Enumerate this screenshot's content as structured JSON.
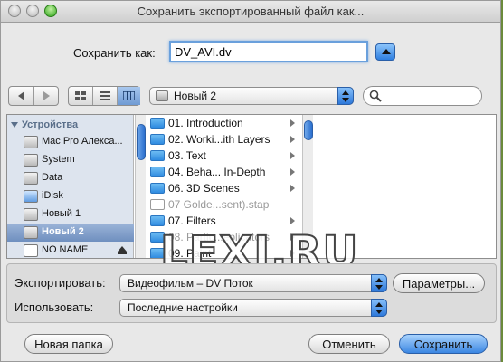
{
  "window": {
    "title": "Сохранить экспортированный файл как..."
  },
  "save": {
    "label": "Сохранить как:",
    "value": "DV_AVI.dv"
  },
  "location": {
    "selected": "Новый 2"
  },
  "sidebar": {
    "heading": "Устройства",
    "items": [
      {
        "label": "Mac Pro Алекса...",
        "icon": "computer-icon"
      },
      {
        "label": "System",
        "icon": "hard-drive-icon"
      },
      {
        "label": "Data",
        "icon": "hard-drive-icon"
      },
      {
        "label": "iDisk",
        "icon": "idisk-icon"
      },
      {
        "label": "Новый 1",
        "icon": "hard-drive-icon"
      },
      {
        "label": "Новый 2",
        "icon": "hard-drive-icon",
        "selected": true
      },
      {
        "label": "NO NAME",
        "icon": "disk-icon",
        "eject": true
      }
    ]
  },
  "files": [
    {
      "label": "01. Introduction",
      "type": "folder"
    },
    {
      "label": "02. Worki...ith Layers",
      "type": "folder"
    },
    {
      "label": "03. Text",
      "type": "folder"
    },
    {
      "label": "04. Beha... In-Depth",
      "type": "folder"
    },
    {
      "label": "06. 3D Scenes",
      "type": "folder"
    },
    {
      "label": "07 Golde...sent).stap",
      "type": "doc"
    },
    {
      "label": "07. Filters",
      "type": "folder"
    },
    {
      "label": "08. Partic...eplicators",
      "type": "folder"
    },
    {
      "label": "09. Paint",
      "type": "folder"
    }
  ],
  "export": {
    "label": "Экспортировать:",
    "value": "Видеофильм – DV Поток",
    "params_button": "Параметры..."
  },
  "use": {
    "label": "Использовать:",
    "value": "Последние настройки"
  },
  "buttons": {
    "new_folder": "Новая папка",
    "cancel": "Отменить",
    "save": "Сохранить"
  },
  "watermark": "LEXI.RU",
  "colors": {
    "accent": "#2f7fe0",
    "selection": "#6f8fbf"
  }
}
